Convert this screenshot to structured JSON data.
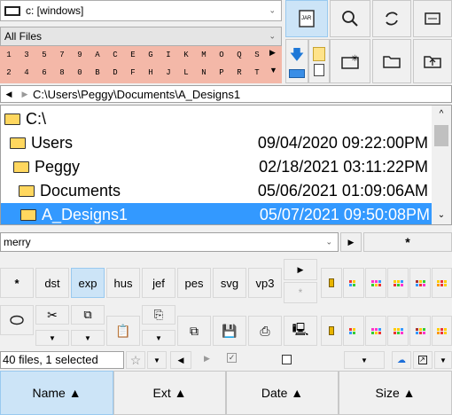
{
  "drive": {
    "label": "c: [windows]"
  },
  "filter": {
    "label": "All Files"
  },
  "drive_letters": [
    "1",
    "3",
    "5",
    "7",
    "9",
    "A",
    "C",
    "E",
    "G",
    "I",
    "K",
    "M",
    "O",
    "Q",
    "S",
    "2",
    "4",
    "6",
    "8",
    "0",
    "B",
    "D",
    "F",
    "H",
    "J",
    "L",
    "N",
    "P",
    "R",
    "T"
  ],
  "path": "C:\\Users\\Peggy\\Documents\\A_Designs1",
  "tree": [
    {
      "name": "C:\\",
      "date": ""
    },
    {
      "name": "Users",
      "date": "09/04/2020 09:22:00PM"
    },
    {
      "name": "Peggy",
      "date": "02/18/2021 03:11:22PM"
    },
    {
      "name": "Documents",
      "date": "05/06/2021 01:09:06AM"
    },
    {
      "name": "A_Designs1",
      "date": "05/07/2021 09:50:08PM"
    }
  ],
  "search": {
    "value": "merry"
  },
  "filetypes": [
    "*",
    "dst",
    "exp",
    "hus",
    "jef",
    "pes",
    "svg",
    "vp3"
  ],
  "star": "*",
  "status": "40 files, 1 selected",
  "columns": [
    "Name ▲",
    "Ext ▲",
    "Date ▲",
    "Size ▲"
  ],
  "accent": "#3399ff"
}
